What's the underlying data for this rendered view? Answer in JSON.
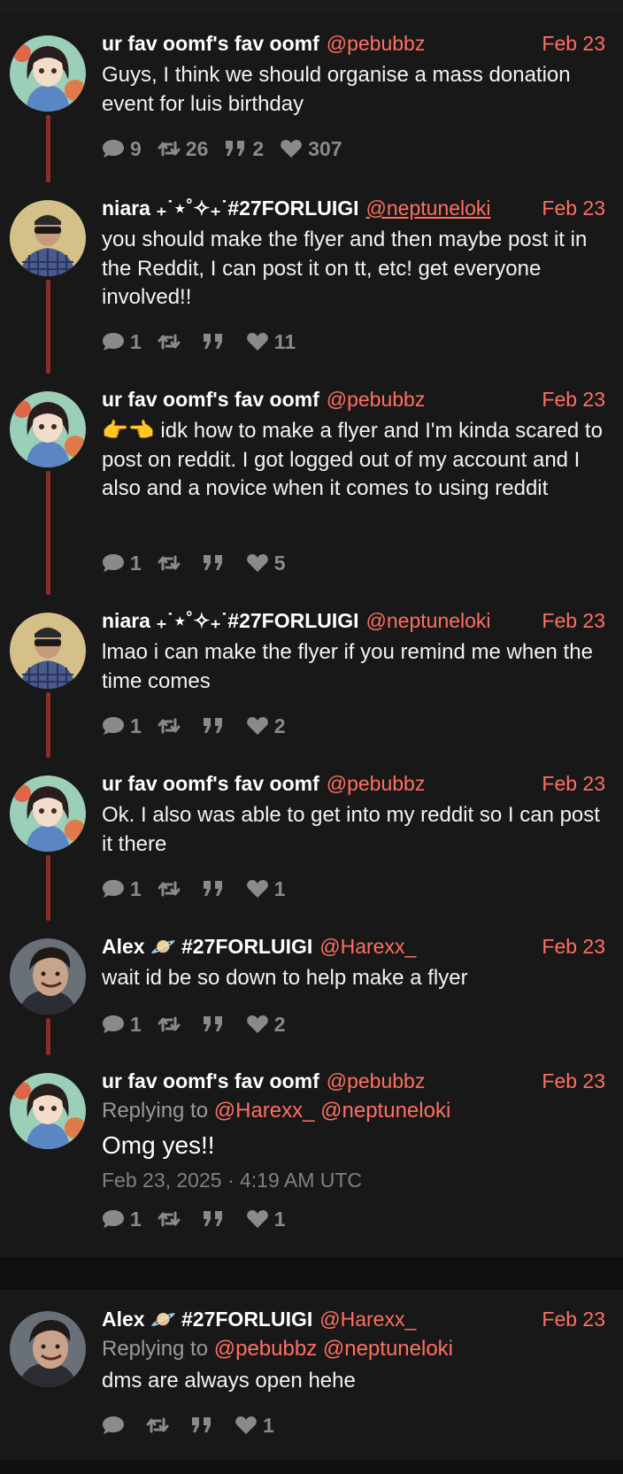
{
  "tweets": [
    {
      "name": "ur fav oomf's fav oomf",
      "handle": "@pebubbz",
      "date": "Feb 23",
      "body": "Guys, I think we should organise a mass donation event for luis birthday",
      "stats": {
        "comments": "9",
        "retweets": "26",
        "quotes": "2",
        "likes": "307"
      },
      "avatar": "anime-girl-avatar"
    },
    {
      "name": "niara ₊˙⋆˚✧₊˙#27FORLUIGI",
      "handle": "@neptuneloki",
      "date": "Feb 23",
      "body": "you should make the flyer and then maybe post it in the Reddit, I can post it on tt, etc! get everyone involved!!",
      "stats": {
        "comments": "1",
        "retweets": "",
        "quotes": "",
        "likes": "11"
      },
      "avatar": "man-plaid-shirt-avatar"
    },
    {
      "name": "ur fav oomf's fav oomf",
      "handle": "@pebubbz",
      "date": "Feb 23",
      "body": "👉👈 idk how to make a flyer and I'm kinda scared to post on reddit. I got logged out of my account and I also and a novice when it comes to using reddit",
      "stats": {
        "comments": "1",
        "retweets": "",
        "quotes": "",
        "likes": "5"
      },
      "avatar": "anime-girl-avatar"
    },
    {
      "name": "niara ₊˙⋆˚✧₊˙#27FORLUIGI",
      "handle": "@neptuneloki",
      "date": "Feb 23",
      "body": "lmao i can make the flyer if you remind me when the time comes",
      "stats": {
        "comments": "1",
        "retweets": "",
        "quotes": "",
        "likes": "2"
      },
      "avatar": "man-plaid-shirt-avatar"
    },
    {
      "name": "ur fav oomf's fav oomf",
      "handle": "@pebubbz",
      "date": "Feb 23",
      "body": "Ok. I also was able to get into my reddit so I can post it there",
      "stats": {
        "comments": "1",
        "retweets": "",
        "quotes": "",
        "likes": "1"
      },
      "avatar": "anime-girl-avatar"
    },
    {
      "name": "Alex 🪐 #27FORLUIGI",
      "handle": "@Harexx_",
      "date": "Feb 23",
      "body": "wait id be so down to help make a flyer",
      "stats": {
        "comments": "1",
        "retweets": "",
        "quotes": "",
        "likes": "2"
      },
      "avatar": "smiling-guy-avatar"
    }
  ],
  "main_tweet": {
    "name": "ur fav oomf's fav oomf",
    "handle": "@pebubbz",
    "date": "Feb 23",
    "replying_prefix": "Replying to",
    "replying_mentions": "@Harexx_ @neptuneloki",
    "body": "Omg yes!!",
    "timestamp": "Feb 23, 2025 · 4:19 AM UTC",
    "stats": {
      "comments": "1",
      "retweets": "",
      "quotes": "",
      "likes": "1"
    },
    "avatar": "anime-girl-avatar"
  },
  "reply_tweet": {
    "name": "Alex 🪐 #27FORLUIGI",
    "handle": "@Harexx_",
    "date": "Feb 23",
    "replying_prefix": "Replying to",
    "replying_mentions": "@pebubbz @neptuneloki",
    "body": "dms are always open hehe",
    "stats": {
      "comments": "",
      "retweets": "",
      "quotes": "",
      "likes": "1"
    },
    "avatar": "smiling-guy-avatar"
  },
  "colors": {
    "background": "#181818",
    "accent": "#ff6f61",
    "thread_line": "#8a2e26",
    "muted": "#8a8a8a"
  }
}
